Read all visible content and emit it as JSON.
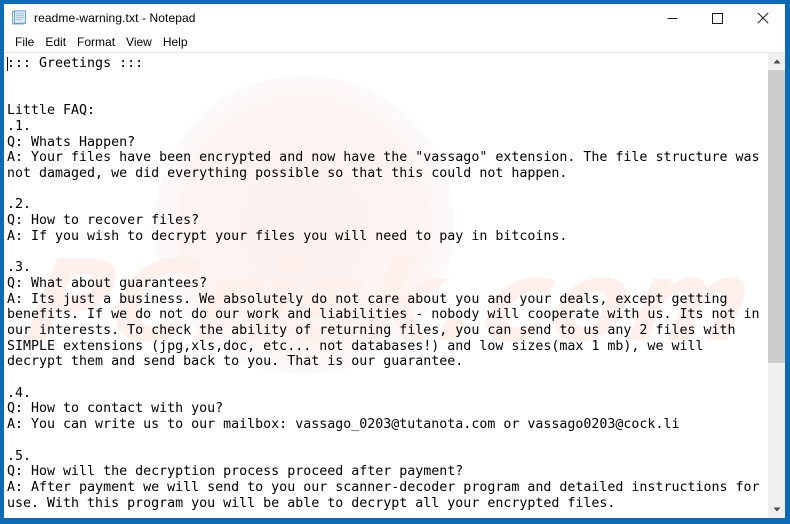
{
  "window": {
    "title": "readme-warning.txt - Notepad",
    "app_icon": "notepad-document-icon",
    "border_color": "#0d6bb5",
    "controls": {
      "minimize": "minimize-button",
      "maximize": "maximize-button",
      "close": "close-button"
    }
  },
  "menu": {
    "items": [
      {
        "label": "File"
      },
      {
        "label": "Edit"
      },
      {
        "label": "Format"
      },
      {
        "label": "View"
      },
      {
        "label": "Help"
      }
    ]
  },
  "editor": {
    "text": "::: Greetings :::\n\n\nLittle FAQ:\n.1.\nQ: Whats Happen?\nA: Your files have been encrypted and now have the \"vassago\" extension. The file structure was not damaged, we did everything possible so that this could not happen.\n\n.2.\nQ: How to recover files?\nA: If you wish to decrypt your files you will need to pay in bitcoins.\n\n.3.\nQ: What about guarantees?\nA: Its just a business. We absolutely do not care about you and your deals, except getting benefits. If we do not do our work and liabilities - nobody will cooperate with us. Its not in our interests. To check the ability of returning files, you can send to us any 2 files with SIMPLE extensions (jpg,xls,doc, etc... not databases!) and low sizes(max 1 mb), we will decrypt them and send back to you. That is our guarantee.\n\n.4.\nQ: How to contact with you?\nA: You can write us to our mailbox: vassago_0203@tutanota.com or vassago0203@cock.li\n\n.5.\nQ: How will the decryption process proceed after payment?\nA: After payment we will send to you our scanner-decoder program and detailed instructions for use. With this program you will be able to decrypt all your encrypted files.",
    "emails": [
      "vassago_0203@tutanota.com",
      "vassago0203@cock.li"
    ],
    "extension": "vassago",
    "background_watermark": "PCrisk.com"
  },
  "scrollbar": {
    "up_arrow": "scroll-up-arrow-icon",
    "down_arrow": "scroll-down-arrow-icon",
    "thumb_color": "#cdcdcd",
    "track_color": "#f0f0f0"
  }
}
